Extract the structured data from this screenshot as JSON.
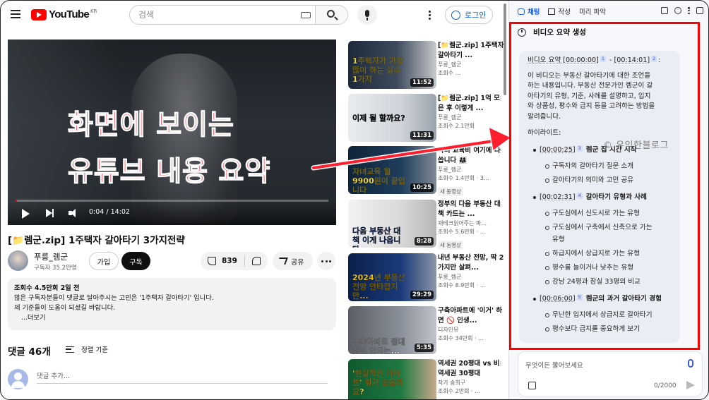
{
  "header": {
    "logo_text": "YouTube",
    "region": "KR",
    "search_placeholder": "검색",
    "login_label": "로그인"
  },
  "video": {
    "time_display": "0:04 / 14:02",
    "progress_fraction": 0.005,
    "title": "[📁렘군.zip] 1주택자 갈아타기 3가지전략"
  },
  "channel": {
    "name": "푸릉_렘군",
    "subscribers": "구독자 35.2만명",
    "join_label": "가입",
    "subscribe_label": "구독",
    "likes": "839",
    "share_label": "공유"
  },
  "description": {
    "stats": "조회수 4.5만회  2일 전",
    "line1": "많은 구독자분들이 댓글로 달아주시는 고민은 '1주택자 갈아타기' 입니다.",
    "line2": "제 기준들이 도움이 되셨길 바랍니다.",
    "more": "...더보기"
  },
  "comments": {
    "count": "댓글 46개",
    "sort_label": "정렬 기준",
    "placeholder": "댓글 추가..."
  },
  "overlay": {
    "line1": "화면에 보이는",
    "line2": "유튜브 내용 요약"
  },
  "recommendations": [
    {
      "thumb_text": "1주택자가 가장 많이 하는 실수 1가지",
      "duration": "11:52",
      "title": "[📁렘군.zip] 1주택자 갈아타기 ...",
      "channel": "푸릉_렘군",
      "views": "조회수 ...",
      "badge": ""
    },
    {
      "thumb_text": "이제 될 할까요?",
      "duration": "11:31",
      "title": "[📁렘군.zip] 1억 모은 후 이렇게 ...",
      "channel": "푸릉_렘군",
      "views": "조회수 2.1만회",
      "badge": ""
    },
    {
      "thumb_text": "자녀교육 월 9900원이 끝입니다",
      "duration": "10:25",
      "title": "자녀 교육비 여기에 다 씁니다 👨‍👩‍👧",
      "channel": "푸릉_렘군",
      "views": "조회수 1.4만회 · 3...",
      "badge": "새 동영상"
    },
    {
      "thumb_text": "다음 부동산 대책 이게 나옵니다",
      "duration": "8:28",
      "title": "정부의 다음 부동산 대책 카드는 ...",
      "channel": "재테크읽어주는 파...",
      "views": "조회수 5.6만회 · ...",
      "badge": "새 동영상"
    },
    {
      "thumb_text": "2024년 부동산 전망 안타깝지만...",
      "duration": "29:29",
      "title": "내년 부동산 전망, 딱 2가지만 살펴...",
      "channel": "푸릉_렘군",
      "views": "조회수 8.9만회 · ...",
      "badge": ""
    },
    {
      "thumb_text": "구축아파트 절대 하면 안되는...",
      "duration": "5:35",
      "title": "구축아파트에 '이거' 하면 🚫 인생...",
      "channel": "디자인뮤",
      "views": "조회수 34만회 · ...",
      "badge": ""
    },
    {
      "thumb_text": "'현실적인 아파트' 뭐가 좋을까요?",
      "duration": "",
      "title": "역세권 20평대 vs 비역세권 30평대",
      "channel": "작가 송희구",
      "views": "조회수 2만회 · ...",
      "badge": ""
    }
  ],
  "panel": {
    "tabs": [
      "채팅",
      "작성",
      "미리 파악"
    ],
    "summary_header": "비디오 요약 생성",
    "range_label": "비디오 요약",
    "range_start": "[00:00:00]",
    "range_ref1": "1",
    "range_sep": "-",
    "range_end": "[00:14:01]",
    "range_ref2": "2",
    "range_colon": ":",
    "intro": [
      "이 비디오는 부동산 갈아타기에 대한 조언을",
      "하는 내용입니다. 부동산 전문가인 렘군이 갈",
      "아타기의 유형, 기준, 사례를 설명하고, 입지",
      "와 상품성, 평수와 급지 등을 고려하는 방법을",
      "알려줍니다."
    ],
    "highlights_label": "하이라이트:",
    "sections": [
      {
        "ts": "[00:00:25]",
        "ref": "3",
        "title": "렘군 집 시간 시작",
        "items": [
          "구독자의 갈아타기 질문 소개",
          "갈아타기의 의미와 고민 공유"
        ]
      },
      {
        "ts": "[00:02:31]",
        "ref": "4",
        "title": "갈아타기 유형과 사례",
        "items": [
          "구도심에서 신도시로 가는 유형",
          "구도심에서 구축에서 신축으로 가는",
          "유형",
          "하급지에서 상급지로 가는 유형",
          "평수를 늘이거나 낮추는 유형",
          "강남 24평과 잠실 33평의 비교"
        ]
      },
      {
        "ts": "[00:06:00]",
        "ref": "5",
        "title": "렘군의 과거 갈아타기 경험",
        "items": [
          "무난한 입지에서 상급지로 갈아타기",
          "평수보다 급지를 중요하게 보기"
        ]
      }
    ],
    "watermark": "© 유익한블로그",
    "chat_placeholder": "무엇이든 물어보세요",
    "char_count": "0/2000"
  },
  "colors": {
    "youtube_red": "#ff0000",
    "accent_blue": "#065fd4",
    "panel_blue": "#1a56db",
    "highlight_red": "#ff0000"
  }
}
